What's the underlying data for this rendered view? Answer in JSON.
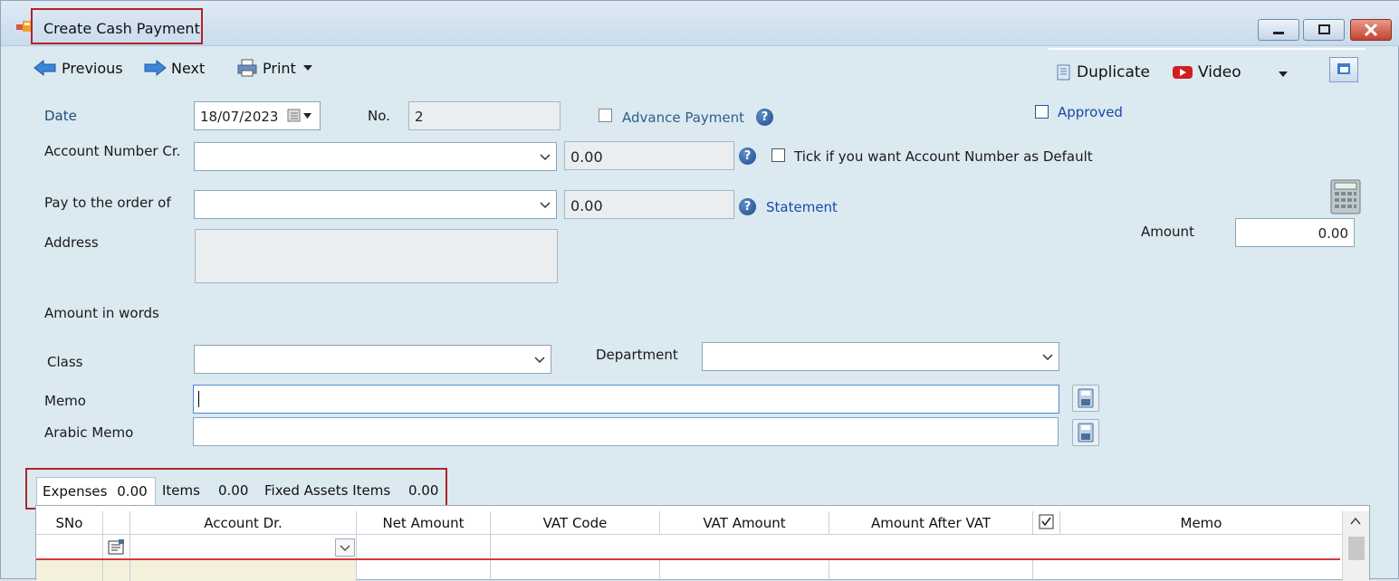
{
  "window": {
    "title": "Create Cash Payment"
  },
  "toolbar": {
    "previous_label": "Previous",
    "next_label": "Next",
    "print_label": "Print",
    "duplicate_label": "Duplicate",
    "video_label": "Video"
  },
  "form": {
    "date_label": "Date",
    "date_value": "18/07/2023",
    "no_label": "No.",
    "no_value": "2",
    "advance_payment_label": "Advance Payment",
    "approved_label": "Approved",
    "account_number_label": "Account Number Cr.",
    "account_balance": "0.00",
    "default_account_label": "Tick if you want Account Number as Default",
    "pay_to_label": "Pay to the order of",
    "pay_to_balance": "0.00",
    "statement_label": "Statement",
    "amount_label": "Amount",
    "amount_value": "0.00",
    "address_label": "Address",
    "amount_words_label": "Amount in words",
    "class_label": "Class",
    "department_label": "Department",
    "memo_label": "Memo",
    "arabic_memo_label": "Arabic Memo"
  },
  "tabs": [
    {
      "label": "Expenses",
      "value": "0.00"
    },
    {
      "label": "Items",
      "value": "0.00"
    },
    {
      "label": "Fixed Assets Items",
      "value": "0.00"
    }
  ],
  "grid": {
    "columns": [
      "SNo",
      "",
      "Account Dr.",
      "Net Amount",
      "VAT Code",
      "VAT Amount",
      "Amount After VAT",
      "",
      "Memo"
    ]
  },
  "colors": {
    "accent_red": "#b02328",
    "link_blue": "#1a4aa8",
    "background": "#dbe9f1"
  }
}
